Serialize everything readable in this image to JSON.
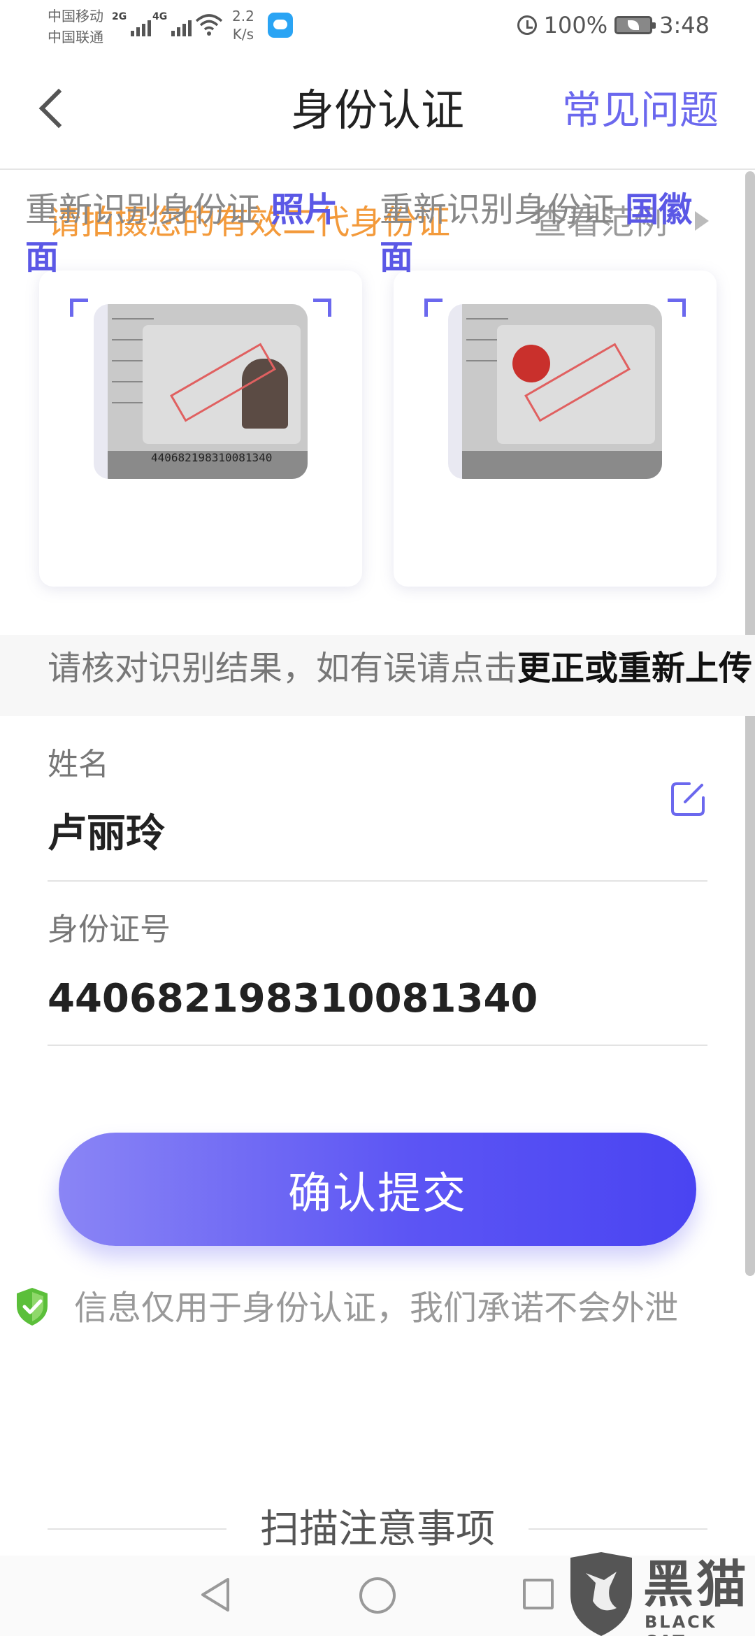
{
  "status_bar": {
    "carrier_1": "中国移动",
    "carrier_2": "中国联通",
    "net_1": "2G",
    "net_2": "4G",
    "speed_value": "2.2",
    "speed_unit": "K/s",
    "battery": "100%",
    "time": "3:48"
  },
  "header": {
    "title": "身份认证",
    "faq": "常见问题"
  },
  "prompt": {
    "text": "请拍摄您的有效二代身份证",
    "example": "查看范例"
  },
  "cards": [
    {
      "label_prefix": "重新识别身份证",
      "label_highlight": "照片",
      "label_suffix": "面",
      "id_number_on_photo": "440682198310081340"
    },
    {
      "label_prefix": "重新识别身份证",
      "label_highlight": "国徽",
      "label_suffix": "面"
    }
  ],
  "verify": {
    "text": "请核对识别结果，如有误请点击",
    "bold": "更正或重新上传"
  },
  "fields": {
    "name_label": "姓名",
    "name_value": "卢丽玲",
    "id_label": "身份证号",
    "id_value": "440682198310081340"
  },
  "submit_label": "确认提交",
  "privacy_text": "信息仅用于身份认证，我们承诺不会外泄",
  "notes_title": "扫描注意事项",
  "watermark": {
    "name": "黑猫",
    "sub": "BLACK CAT"
  },
  "colors": {
    "accent": "#6b68ee",
    "prompt_orange": "#f39a3b",
    "button_start": "#8a85f5",
    "button_end": "#4a44f2",
    "shield_green": "#5bbf3a"
  }
}
